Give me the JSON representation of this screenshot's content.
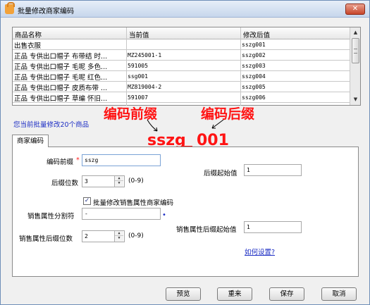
{
  "window": {
    "title": "批量修改商家编码",
    "close_label": "✕"
  },
  "table": {
    "headers": [
      "商品名称",
      "当前值",
      "修改后值"
    ],
    "rows": [
      [
        "出售衣服",
        "",
        "sszg001"
      ],
      [
        "正品 专供出口帽子 布带结 时...",
        "MZ245001-1",
        "sszg002"
      ],
      [
        "正品 专供出口帽子 毛呢 多色...",
        "591005",
        "sszg003"
      ],
      [
        "正品 专供出口帽子 毛呢 红色...",
        "ssg001",
        "sszg004"
      ],
      [
        "正品 专供出口帽子 皮质布带 ...",
        "MZ819004-2",
        "sszg005"
      ],
      [
        "正品 专供出口帽子 草编 怀旧...",
        "591007",
        "sszg006"
      ]
    ]
  },
  "annotations": {
    "prefix_caption": "编码前缀",
    "suffix_caption": "编码后缀",
    "prefix_value": "sszg",
    "suffix_value": "001"
  },
  "info_text": "您当前批量修改20个商品",
  "tab_label": "商家编码",
  "form": {
    "prefix_label": "编码前缀",
    "prefix_required": "*",
    "prefix_value": "sszg",
    "suffix_digits_label": "后缀位数",
    "suffix_digits_value": "3",
    "suffix_digits_hint": "(0-9)",
    "suffix_start_label": "后缀起始值",
    "suffix_start_value": "1",
    "checkbox_label": "批量修改销售属性商家编码",
    "checkbox_checked": true,
    "separator_label": "销售属性分割符",
    "separator_value": "-",
    "attr_digits_label": "销售属性后缀位数",
    "attr_digits_value": "2",
    "attr_digits_hint": "(0-9)",
    "attr_start_label": "销售属性后缀起始值",
    "attr_start_value": "1",
    "help_link": "如何设置?"
  },
  "buttons": {
    "preview": "预览",
    "reset": "重来",
    "save": "保存",
    "cancel": "取消"
  },
  "colors": {
    "annotation": "#ff1414",
    "link": "#1d2ec4",
    "close": "#c7462b"
  },
  "icons": [
    "app-icon",
    "close-icon",
    "scroll-up-icon",
    "scroll-down-icon",
    "spin-up-icon",
    "spin-down-icon",
    "check-icon"
  ]
}
